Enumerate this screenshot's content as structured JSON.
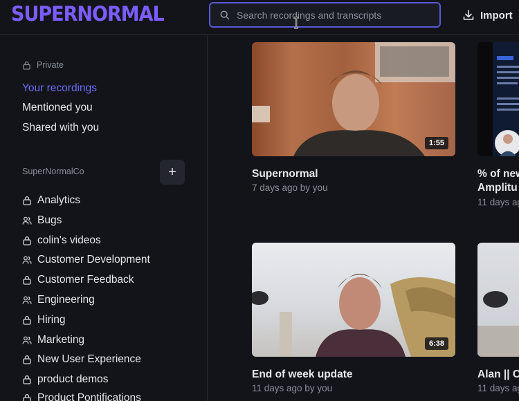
{
  "app": {
    "logo": "Supernormal",
    "brand_color": "#7c5cff",
    "accent": "#6d6cf5"
  },
  "header": {
    "search_placeholder": "Search recordings and transcripts",
    "import_label": "Import"
  },
  "sidebar": {
    "private_label": "Private",
    "links": [
      {
        "label": "Your recordings",
        "active": true
      },
      {
        "label": "Mentioned you",
        "active": false
      },
      {
        "label": "Shared with you",
        "active": false
      }
    ],
    "team_label": "SuperNormalCo",
    "add_label": "+",
    "folders": [
      {
        "label": "Analytics",
        "icon": "lock-icon"
      },
      {
        "label": "Bugs",
        "icon": "users-icon"
      },
      {
        "label": "colin's videos",
        "icon": "lock-icon"
      },
      {
        "label": "Customer Development",
        "icon": "users-icon"
      },
      {
        "label": "Customer Feedback",
        "icon": "lock-icon"
      },
      {
        "label": "Engineering",
        "icon": "users-icon"
      },
      {
        "label": "Hiring",
        "icon": "lock-icon"
      },
      {
        "label": "Marketing",
        "icon": "users-icon"
      },
      {
        "label": "New User Experience",
        "icon": "lock-icon"
      },
      {
        "label": "product demos",
        "icon": "lock-icon"
      },
      {
        "label": "Product Pontifications",
        "icon": "lock-icon"
      }
    ]
  },
  "recordings": [
    {
      "title": "Supernormal",
      "meta": "7 days ago by you",
      "duration": "1:55"
    },
    {
      "title": "% of new",
      "subtitle": "Amplitu",
      "meta": "11 days ag",
      "duration": ""
    },
    {
      "title": "End of week update",
      "meta": "11 days ago by you",
      "duration": "6:38"
    },
    {
      "title": "Alan || C",
      "meta": "11 days ag",
      "duration": ""
    }
  ]
}
